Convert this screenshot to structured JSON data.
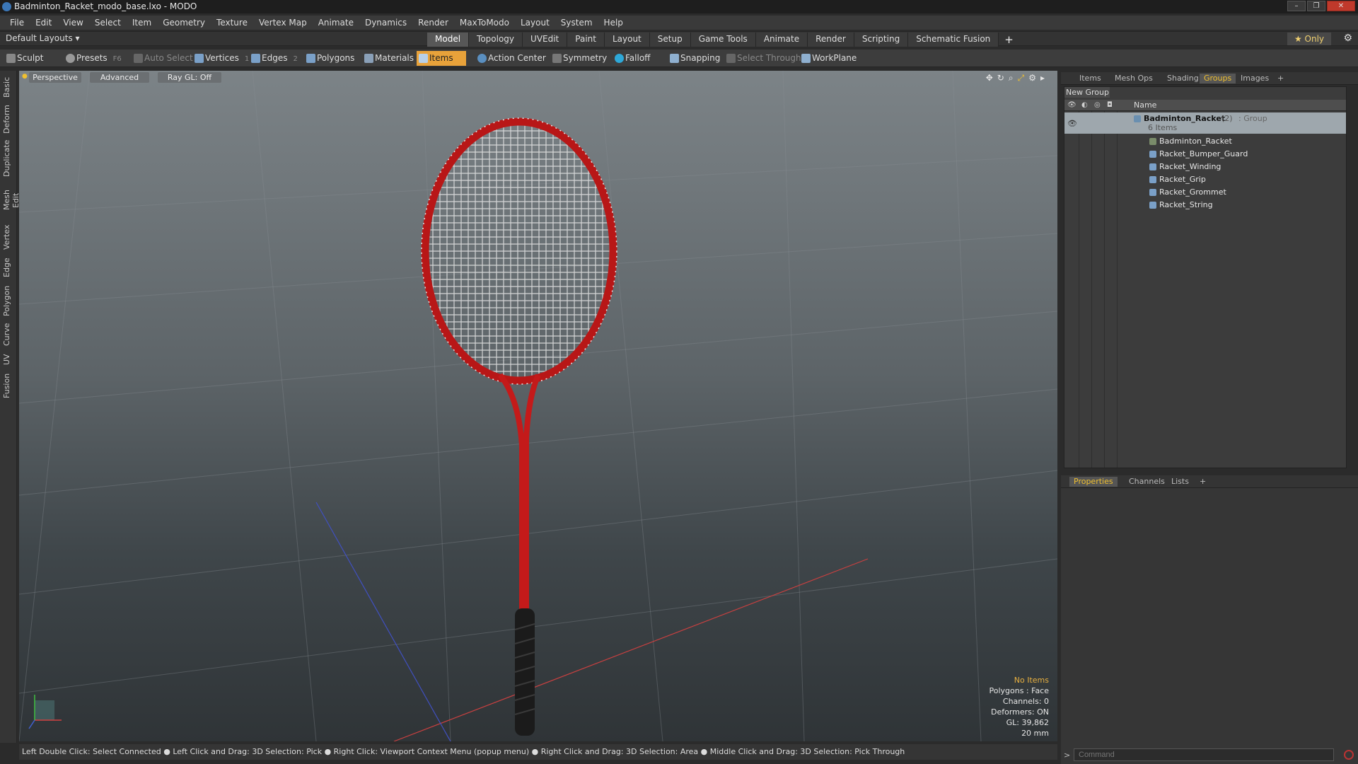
{
  "window": {
    "title": "Badminton_Racket_modo_base.lxo - MODO"
  },
  "menu": [
    "File",
    "Edit",
    "View",
    "Select",
    "Item",
    "Geometry",
    "Texture",
    "Vertex Map",
    "Animate",
    "Dynamics",
    "Render",
    "MaxToModo",
    "Layout",
    "System",
    "Help"
  ],
  "layout": {
    "default_layouts": "Default Layouts ▾",
    "tabs": [
      "Model",
      "Topology",
      "UVEdit",
      "Paint",
      "Layout",
      "Setup",
      "Game Tools",
      "Animate",
      "Render",
      "Scripting",
      "Schematic Fusion"
    ],
    "active_tab": "Model",
    "plus": "+",
    "only": "★ Only"
  },
  "toolbar": {
    "sculpt": "Sculpt",
    "presets": "Presets",
    "presets_key": "F6",
    "auto_select": "Auto Select",
    "vertices": "Vertices",
    "vertices_count": "1",
    "edges": "Edges",
    "edges_count": "2",
    "polygons": "Polygons",
    "materials": "Materials",
    "items": "Items",
    "action_center": "Action Center",
    "symmetry": "Symmetry",
    "falloff": "Falloff",
    "snapping": "Snapping",
    "select_through": "Select Through",
    "workplane": "WorkPlane"
  },
  "left_tabs": [
    "Basic",
    "Deform",
    "Duplicate",
    "Mesh Edit",
    "Vertex",
    "Edge",
    "Polygon",
    "Curve",
    "UV",
    "Fusion"
  ],
  "viewport": {
    "perspective": "Perspective",
    "advanced": "Advanced",
    "raygl": "Ray GL: Off",
    "status": {
      "no_items": "No Items",
      "polygons": "Polygons : Face",
      "channels": "Channels: 0",
      "deformers": "Deformers: ON",
      "gl": "GL: 39,862",
      "scale": "20 mm"
    }
  },
  "statusbar": "Left Double Click: Select Connected ● Left Click and Drag: 3D Selection: Pick ● Right Click: Viewport Context Menu (popup menu) ● Right Click and Drag: 3D Selection: Area ● Middle Click and Drag: 3D Selection: Pick Through",
  "panel": {
    "tabs": [
      "Items",
      "Mesh Ops",
      "Shading",
      "Groups",
      "Images"
    ],
    "active_tab": "Groups",
    "plus": "+",
    "new_group": "New Group",
    "name_col": "Name",
    "group_name": "Badminton_Racket",
    "group_count": "(2)",
    "group_type": ": Group",
    "group_items": "6 Items",
    "items": [
      "Badminton_Racket",
      "Racket_Bumper_Guard",
      "Racket_Winding",
      "Racket_Grip",
      "Racket_Grommet",
      "Racket_String"
    ]
  },
  "props": {
    "tabs": [
      "Properties",
      "Channels",
      "Lists"
    ],
    "active_tab": "Properties",
    "plus": "+",
    "command_placeholder": "Command"
  },
  "colors": {
    "accent": "#e8a23a",
    "racket": "#c41a1a",
    "grip": "#1b1b1b"
  }
}
